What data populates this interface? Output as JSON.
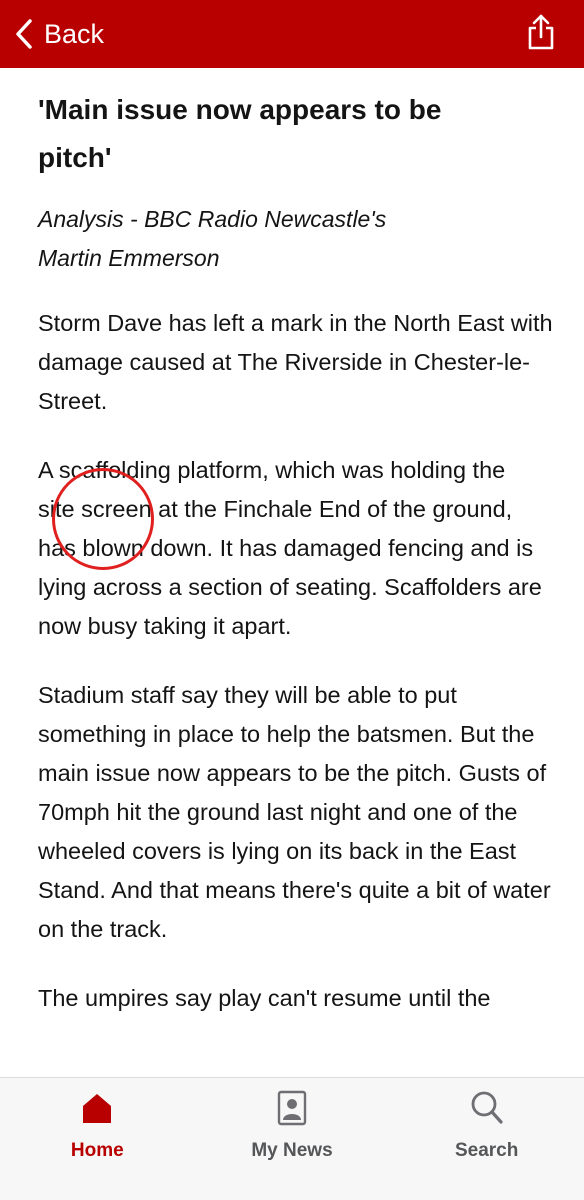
{
  "header": {
    "back_label": "Back",
    "accent_color": "#b80000",
    "icons": {
      "back": "chevron-left-icon",
      "share": "share-icon"
    }
  },
  "article": {
    "headline": "'Main issue now appears to be pitch'",
    "byline": "Analysis - BBC Radio Newcastle's Martin Emmerson",
    "paragraphs": [
      "Storm Dave has left a mark in the North East with damage caused at The Riverside in Chester-le-Street.",
      "A scaffolding platform, which was holding the site screen at the Finchale End of the ground, has blown down. It has damaged fencing and is lying across a section of seating. Scaffolders are now busy taking it apart.",
      "Stadium staff say they will be able to put something in place to help the batsmen. But the main issue now appears to be the pitch. Gusts of 70mph hit the ground last night and one of the wheeled covers is lying on its back in the East Stand. And that means there's quite a bit of water on the track.",
      "The umpires say play can't resume until the"
    ]
  },
  "bottom_nav": {
    "items": [
      {
        "label": "Home",
        "icon": "home-icon",
        "active": true
      },
      {
        "label": "My News",
        "icon": "my-news-icon",
        "active": false
      },
      {
        "label": "Search",
        "icon": "search-icon",
        "active": false
      }
    ]
  }
}
